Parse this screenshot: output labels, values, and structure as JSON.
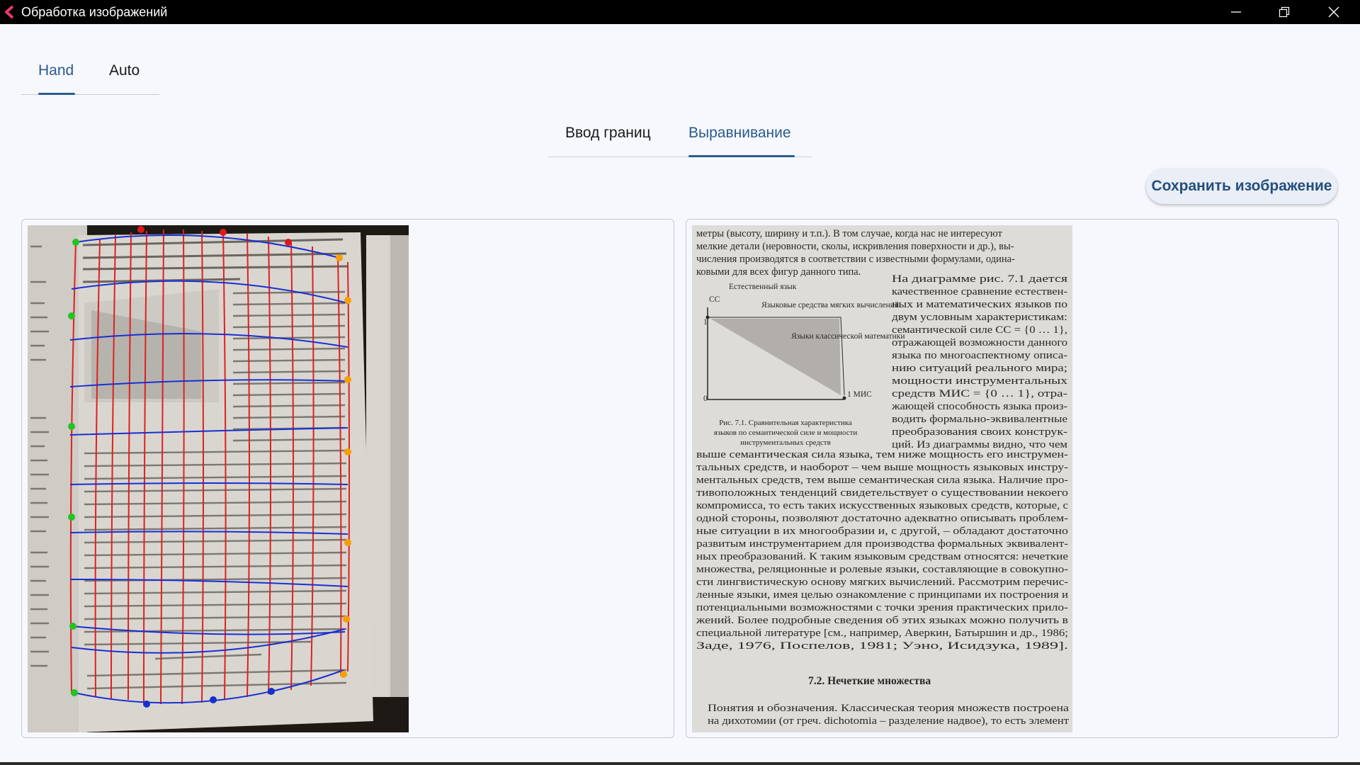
{
  "window": {
    "title": "Обработка изображений",
    "controls": [
      "minimize-icon",
      "restore-icon",
      "close-icon"
    ]
  },
  "mode_tabs": [
    {
      "label": "Hand",
      "active": true
    },
    {
      "label": "Auto",
      "active": false
    }
  ],
  "sub_tabs": [
    {
      "label": "Ввод границ",
      "active": false
    },
    {
      "label": "Выравнивание",
      "active": true
    }
  ],
  "save_button": {
    "label": "Сохранить изображение"
  },
  "left_panel": {
    "image": "source-photo-with-grid",
    "colors": {
      "grid_vertical": "#e02020",
      "grid_horizontal": "#1a2fd0",
      "marker_green": "#22c322",
      "marker_orange": "#f5a000",
      "marker_red": "#e01818",
      "marker_blue": "#1530d0"
    }
  },
  "right_panel": {
    "image": "aligned-page-image",
    "text_lines": [
      "метры (высоту, ширину и т.п.). В том случае, когда нас не интересуют",
      "мелкие детали (неровности, сколы, искривления поверхности и др.), вы-",
      "числения производятся в соответствии с известными формулами, одина-",
      "ковыми для всех фигур данного типа."
    ],
    "figure_labels": {
      "natural": "Естественный язык",
      "soft": "Языковые средства мягких вычислений",
      "classic": "Языки классической математики",
      "cc": "СС",
      "one": "1",
      "zero": "0",
      "mis": "1 МИС"
    },
    "figure_caption": [
      "Рис. 7.1. Сравнительная характеристика",
      "языков по семантической силе и мощности",
      "инструментальных средств"
    ],
    "column_lines": [
      "На диаграмме рис. 7.1 дается",
      "качественное сравнение естествен-",
      "ных и математических языков по",
      "двум условным характеристикам:",
      "семантической силе СС = {0 … 1},",
      "отражающей возможности данного",
      "языка по многоаспектному описа-",
      "нию ситуаций реального мира;",
      "мощности инструментальных",
      "средств МИС = {0 … 1}, отра-",
      "жающей способность языка произ-",
      "водить формально-эквивалентные",
      "преобразования своих конструк-",
      "ций. Из диаграммы видно, что чем"
    ],
    "body_lines": [
      "выше семантическая сила языка, тем ниже мощность его инструмен-",
      "тальных средств, и наоборот – чем выше мощность языковых инстру-",
      "ментальных средств, тем выше семантическая сила языка. Наличие про-",
      "тивоположных тенденций свидетельствует о существовании некоего",
      "компромисса, то есть таких искусственных языковых средств, которые, с",
      "одной стороны, позволяют достаточно адекватно описывать проблем-",
      "ные ситуации в их многообразии и, с другой, – обладают достаточно",
      "развитым инструментарием для производства формальных эквивалент-",
      "ных преобразований. К таким языковым средствам относятся: нечеткие",
      "множества, реляционные и ролевые языки, составляющие в совокупно-",
      "сти лингвистическую основу мягких вычислений. Рассмотрим перечис-",
      "ленные языки, имея целью ознакомление с принципами их построения и",
      "потенциальными возможностями с точки зрения практических прило-",
      "жений. Более подробные сведения об этих языках можно получить в",
      "специальной литературе [см., например, Аверкин, Батыршин и др., 1986;",
      "Заде, 1976, Поспелов, 1981; Уэно, Исидзука, 1989]."
    ],
    "section_heading": "7.2. Нечеткие множества",
    "final_lines": [
      "Понятия и обозначения. Классическая теория множеств построена",
      "на дихотомии (от греч. dichotomia – разделение надвое), то есть элемент"
    ]
  }
}
